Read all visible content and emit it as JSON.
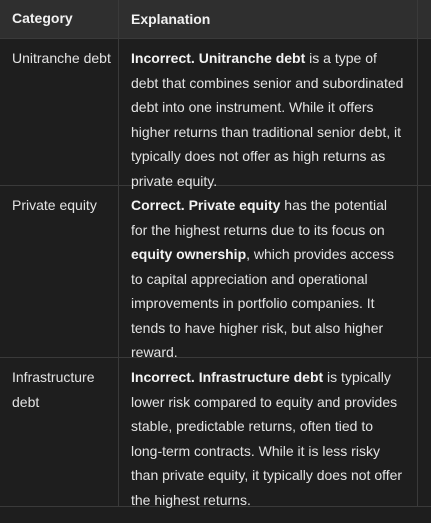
{
  "header": {
    "category": "Category",
    "explanation": "Explanation"
  },
  "rows": [
    {
      "category": "Unitranche debt",
      "verdict": "Incorrect",
      "term": "Unitranche debt",
      "text1": " is a type of debt that combines senior and subordinated debt into one instrument. While it offers higher returns than traditional senior debt, it typically does not offer as high returns as private equity."
    },
    {
      "category": "Private equity",
      "verdict": "Correct",
      "term": "Private equity",
      "text1": " has the potential for the highest returns due to its focus on ",
      "term2": "equity ownership",
      "text2": ", which provides access to capital appreciation and operational improvements in portfolio companies. It tends to have higher risk, but also higher reward."
    },
    {
      "category": "Infrastructure debt",
      "verdict": "Incorrect",
      "term": "Infrastructure debt",
      "text1": " is typically lower risk compared to equity and provides stable, predictable returns, often tied to long-term contracts. While it is less risky than private equity, it typically does not offer the highest returns."
    }
  ],
  "punctuation": {
    "period": ". "
  }
}
